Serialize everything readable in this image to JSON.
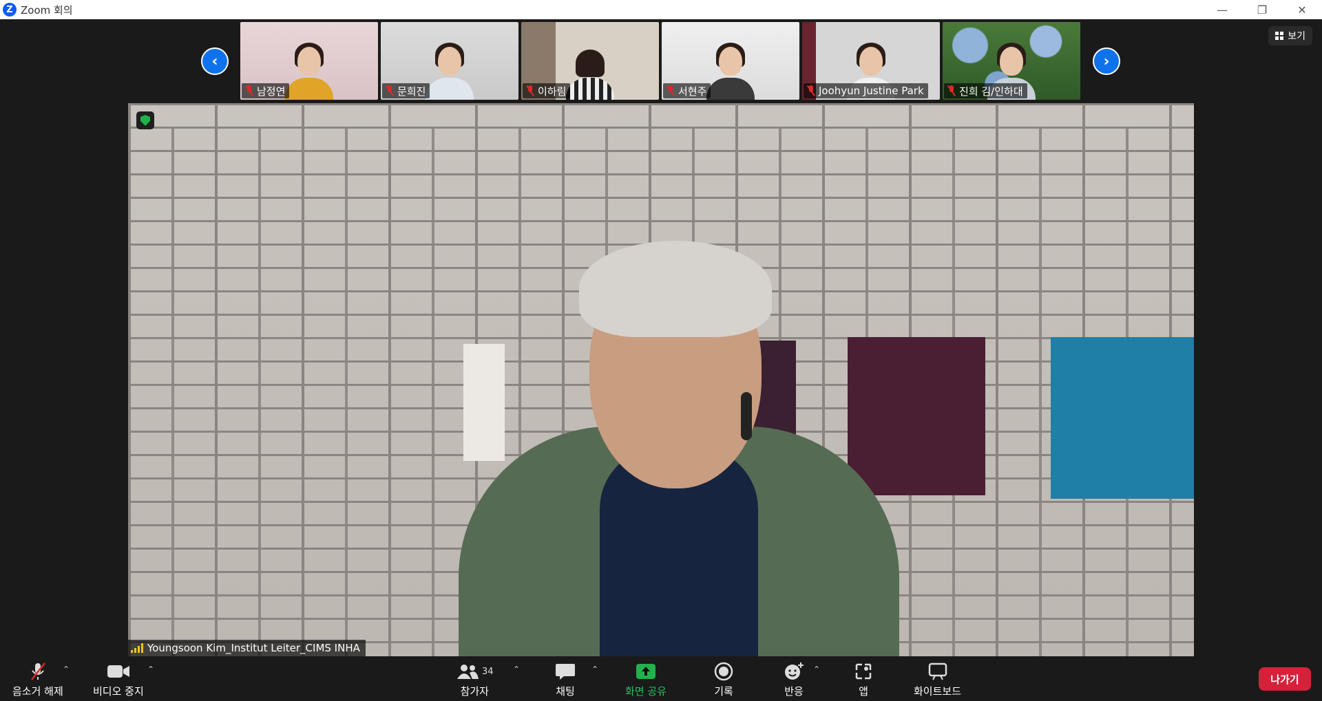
{
  "window": {
    "title": "Zoom 회의",
    "logo_letter": "Z",
    "minimize": "—",
    "restore": "❐",
    "close": "✕"
  },
  "view_button": {
    "label": "보기"
  },
  "participants_strip": [
    {
      "name": "남정연",
      "muted": true
    },
    {
      "name": "문희진",
      "muted": true
    },
    {
      "name": "이하림",
      "muted": true
    },
    {
      "name": "서현주",
      "muted": true
    },
    {
      "name": "Joohyun Justine Park",
      "muted": true
    },
    {
      "name": "진희 김/인하대",
      "muted": true
    }
  ],
  "nav": {
    "prev": "‹",
    "next": "›"
  },
  "active_speaker": {
    "name": "Youngsoon Kim_Institut Leiter_CIMS INHA"
  },
  "toolbar": {
    "unmute_label": "음소거 해제",
    "stop_video_label": "비디오 중지",
    "participants_label": "참가자",
    "participants_count": "34",
    "chat_label": "채팅",
    "share_screen_label": "화면 공유",
    "record_label": "기록",
    "reactions_label": "반응",
    "apps_label": "앱",
    "whiteboard_label": "화이트보드",
    "leave_label": "나가기",
    "caret": "⌃"
  },
  "colors": {
    "accent_blue": "#0e72ed",
    "share_green": "#22b14c",
    "leave_red": "#d6213a",
    "muted_red": "#e02828"
  }
}
